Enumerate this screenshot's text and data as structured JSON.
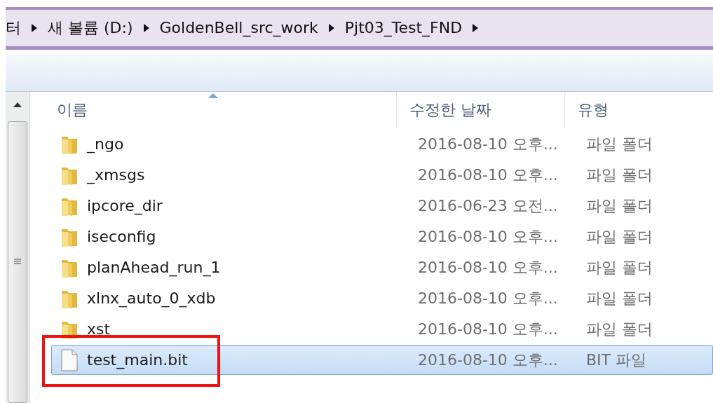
{
  "breadcrumb": [
    "터",
    "새 볼륨 (D:)",
    "GoldenBell_src_work",
    "Pjt03_Test_FND"
  ],
  "columns": [
    {
      "label": "이름",
      "sorted": true
    },
    {
      "label": "수정한 날짜",
      "sorted": false
    },
    {
      "label": "유형",
      "sorted": false
    }
  ],
  "rows": [
    {
      "name": "_ngo",
      "date": "2016-08-10 오후...",
      "type": "파일 폴더",
      "kind": "folder",
      "selected": false
    },
    {
      "name": "_xmsgs",
      "date": "2016-08-10 오후...",
      "type": "파일 폴더",
      "kind": "folder",
      "selected": false
    },
    {
      "name": "ipcore_dir",
      "date": "2016-06-23 오전...",
      "type": "파일 폴더",
      "kind": "folder",
      "selected": false
    },
    {
      "name": "iseconfig",
      "date": "2016-08-10 오후...",
      "type": "파일 폴더",
      "kind": "folder",
      "selected": false
    },
    {
      "name": "planAhead_run_1",
      "date": "2016-08-10 오후...",
      "type": "파일 폴더",
      "kind": "folder",
      "selected": false
    },
    {
      "name": "xlnx_auto_0_xdb",
      "date": "2016-08-10 오후...",
      "type": "파일 폴더",
      "kind": "folder",
      "selected": false
    },
    {
      "name": "xst",
      "date": "2016-08-10 오후...",
      "type": "파일 폴더",
      "kind": "folder",
      "selected": false
    },
    {
      "name": "test_main.bit",
      "date": "2016-08-10 오후...",
      "type": "BIT 파일",
      "kind": "file",
      "selected": true
    }
  ]
}
